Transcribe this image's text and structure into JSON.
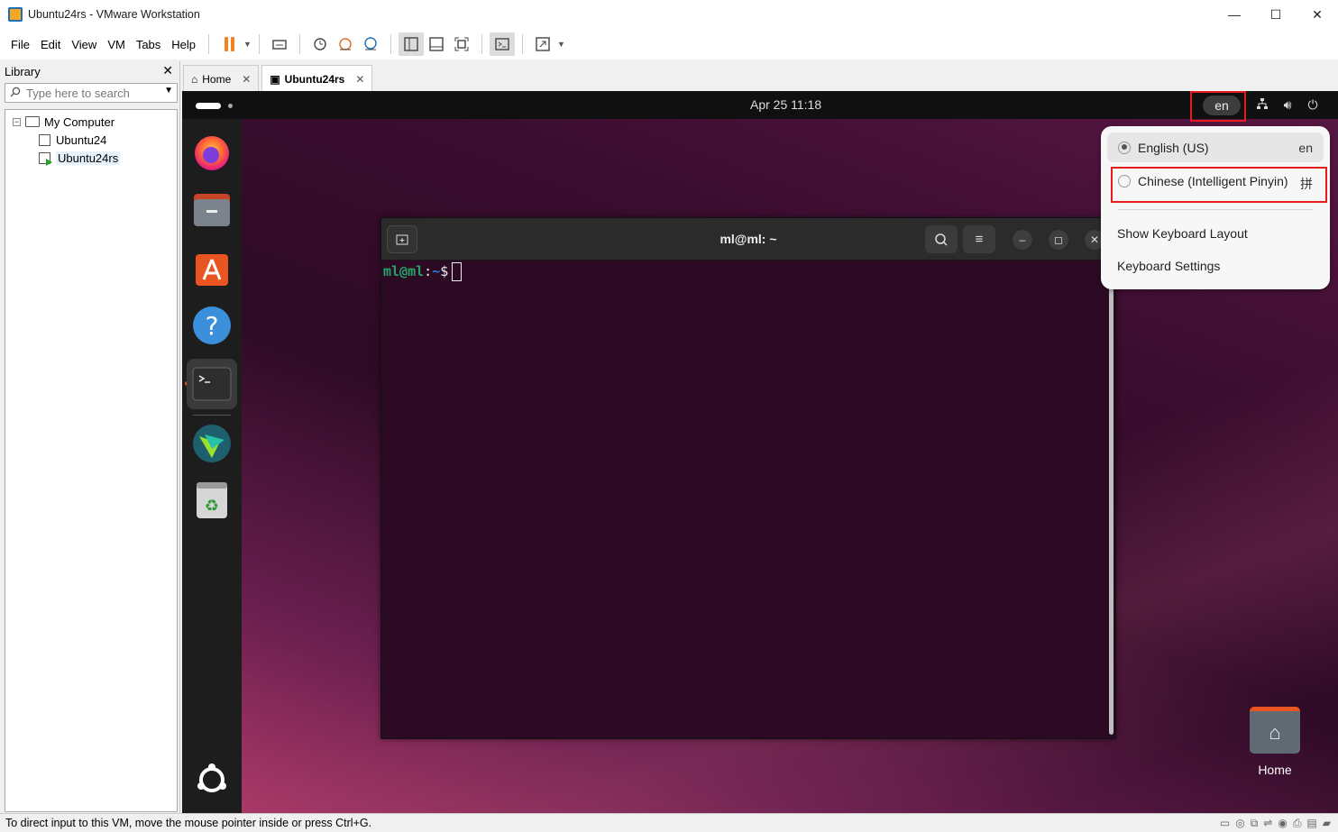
{
  "window": {
    "title": "Ubuntu24rs - VMware Workstation",
    "minimize": "—",
    "maximize": "☐",
    "close": "✕"
  },
  "menu": {
    "items": [
      "File",
      "Edit",
      "View",
      "VM",
      "Tabs",
      "Help"
    ]
  },
  "library": {
    "title": "Library",
    "close": "✕",
    "search_placeholder": "Type here to search",
    "tree": {
      "root": "My Computer",
      "root_toggle": "−",
      "vms": [
        "Ubuntu24",
        "Ubuntu24rs"
      ]
    }
  },
  "tabs": [
    {
      "label": "Home",
      "close": "✕"
    },
    {
      "label": "Ubuntu24rs",
      "close": "✕"
    }
  ],
  "guest": {
    "clock": "Apr 25  11:18",
    "lang_indicator": "en",
    "terminal": {
      "title": "ml@ml: ~",
      "prompt_user": "ml@ml",
      "prompt_sep": ":",
      "prompt_path": "~",
      "prompt_symbol": "$"
    },
    "lang_menu": {
      "sources": [
        {
          "name": "English (US)",
          "code": "en",
          "selected": true
        },
        {
          "name": "Chinese (Intelligent Pinyin)",
          "code": "拼",
          "selected": false
        }
      ],
      "actions": [
        "Show Keyboard Layout",
        "Keyboard Settings"
      ]
    },
    "desktop": {
      "home_label": "Home"
    }
  },
  "statusbar": {
    "message": "To direct input to this VM, move the mouse pointer inside or press Ctrl+G."
  },
  "colors": {
    "highlight": "#e51c1c",
    "ubuntu_orange": "#e95420",
    "terminal_bg": "#2c0a24"
  }
}
